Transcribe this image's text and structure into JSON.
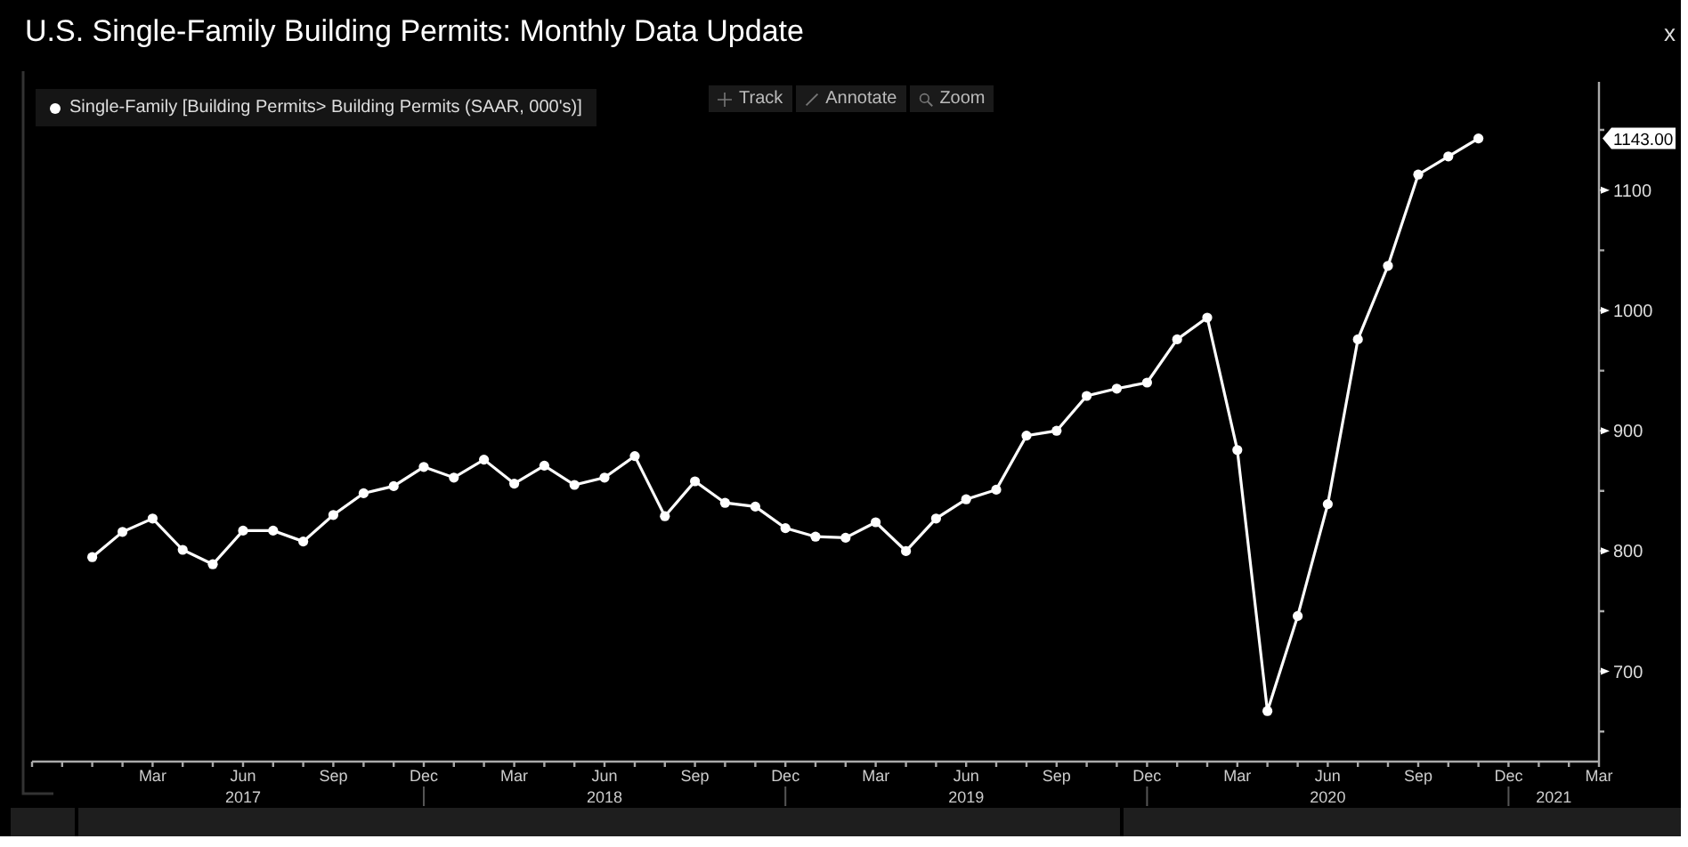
{
  "window": {
    "title": "U.S. Single-Family Building Permits: Monthly Data Update",
    "close": "x"
  },
  "toolbar": [
    {
      "kind": "track",
      "label": "Track"
    },
    {
      "kind": "annotate",
      "label": "Annotate"
    },
    {
      "kind": "zoom",
      "label": "Zoom"
    }
  ],
  "chart": {
    "last_value": "1143.00",
    "year_labels": [
      "2017",
      "2018",
      "2019",
      "2020",
      "2021"
    ],
    "chart_data": {
      "type": "line",
      "categories": [
        null,
        null,
        null,
        null,
        "Mar",
        null,
        null,
        "Jun",
        null,
        null,
        "Sep",
        null,
        null,
        "Dec",
        null,
        null,
        "Mar",
        null,
        null,
        "Jun",
        null,
        null,
        "Sep",
        null,
        null,
        "Dec",
        null,
        null,
        "Mar",
        null,
        null,
        "Jun",
        null,
        null,
        "Sep",
        null,
        null,
        "Dec",
        null,
        null,
        "Mar",
        null,
        null,
        "Jun",
        null,
        null,
        "Sep",
        null,
        null,
        "Dec",
        null,
        null,
        "Mar"
      ],
      "series": [
        {
          "name": "Single-Family [Building Permits> Building Permits (SAAR, 000's)]",
          "color": "#ffffff",
          "marker": "circle",
          "values": [
            null,
            null,
            795,
            816,
            827,
            801,
            789,
            817,
            817,
            808,
            830,
            848,
            854,
            870,
            861,
            876,
            856,
            871,
            855,
            861,
            879,
            829,
            858,
            840,
            837,
            819,
            812,
            811,
            824,
            800,
            827,
            843,
            851,
            896,
            900,
            929,
            935,
            940,
            976,
            994,
            884,
            667,
            746,
            839,
            976,
            1037,
            1113,
            1128,
            1143,
            null,
            null,
            null,
            null
          ]
        }
      ],
      "ylim": [
        625,
        1190
      ],
      "yticks": [
        700,
        800,
        900,
        1000,
        1100
      ]
    }
  },
  "status_bar": [
    {
      "kind": "panel"
    },
    {
      "kind": "panel"
    },
    {
      "kind": "panel"
    }
  ]
}
